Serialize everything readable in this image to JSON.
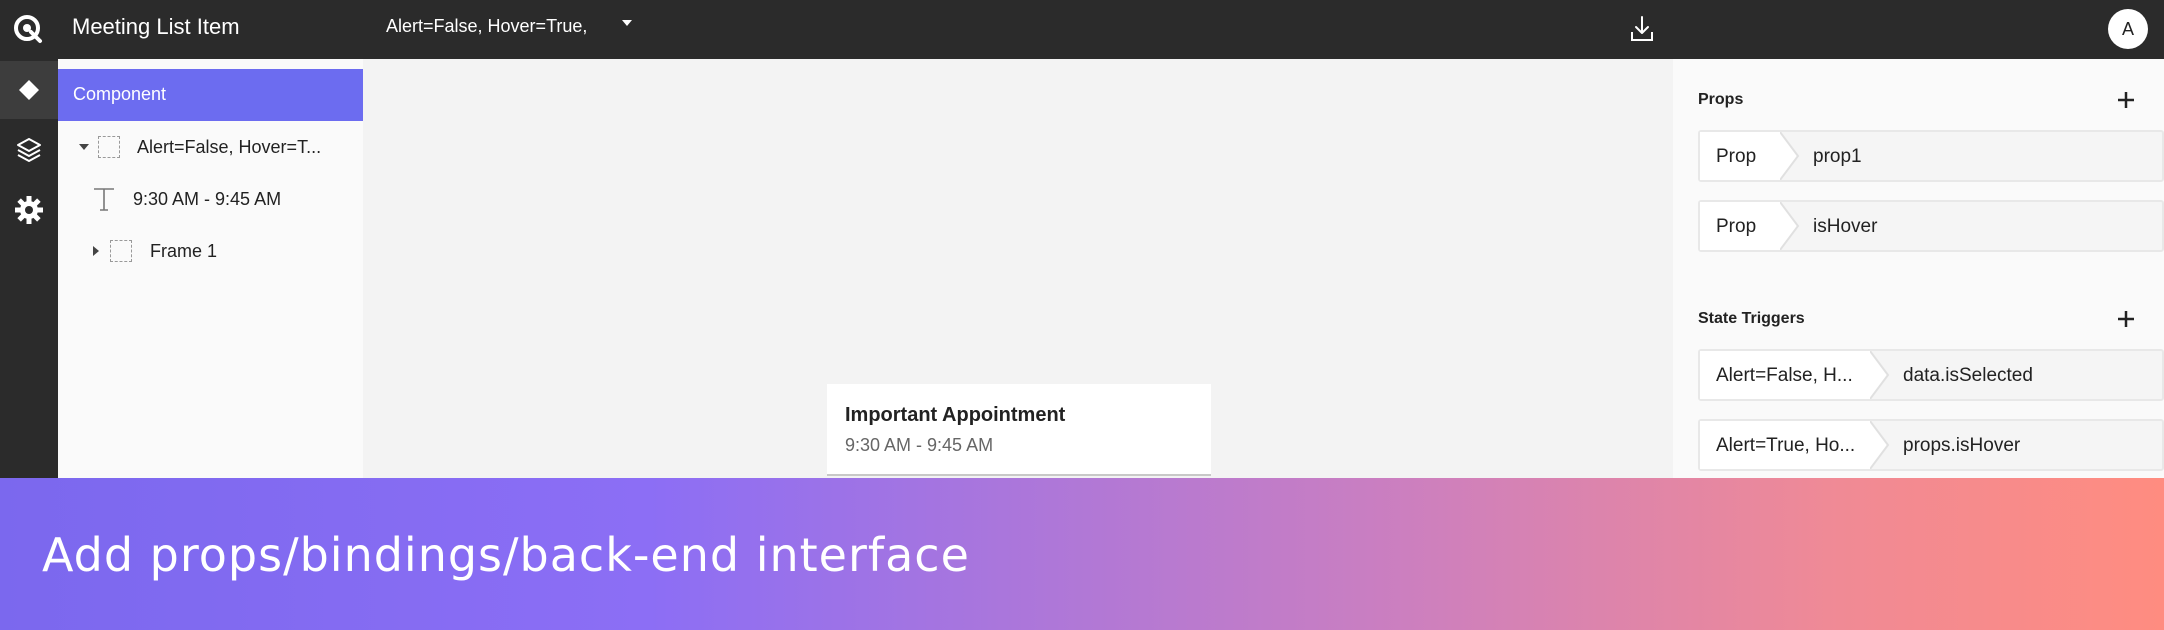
{
  "topbar": {
    "title": "Meeting List Item",
    "variant": "Alert=False, Hover=True,",
    "avatar_initial": "A",
    "logo_icon": "app-logo-icon",
    "caret_icon": "caret-down-icon",
    "download_icon": "download-icon"
  },
  "rail": {
    "items": [
      {
        "icon": "component-diamond-icon",
        "active": true
      },
      {
        "icon": "layers-icon",
        "active": false
      },
      {
        "icon": "gear-icon",
        "active": false
      }
    ]
  },
  "layers": {
    "header": "Component",
    "rows": [
      {
        "label": "Alert=False, Hover=T...",
        "icon": "frame-icon",
        "expand": "caret-down-icon"
      },
      {
        "label": "9:30 AM - 9:45 AM",
        "icon": "text-icon"
      },
      {
        "label": "Frame 1",
        "icon": "frame-icon",
        "expand": "caret-right-icon"
      }
    ]
  },
  "canvas": {
    "card": {
      "title": "Important Appointment",
      "time": "9:30 AM - 9:45 AM"
    }
  },
  "props": {
    "title": "Props",
    "rows": [
      {
        "key": "Prop",
        "value": "prop1"
      },
      {
        "key": "Prop",
        "value": "isHover"
      }
    ]
  },
  "state_triggers": {
    "title": "State Triggers",
    "rows": [
      {
        "key": "Alert=False, H...",
        "value": "data.isSelected"
      },
      {
        "key": "Alert=True, Ho...",
        "value": "props.isHover"
      }
    ]
  },
  "banner": {
    "text": "Add props/bindings/back-end interface"
  },
  "colors": {
    "accent": "#6c6cf0",
    "topbar": "#2b2b2b",
    "banner_start": "#7b68ee",
    "banner_end": "#ff8c80"
  }
}
